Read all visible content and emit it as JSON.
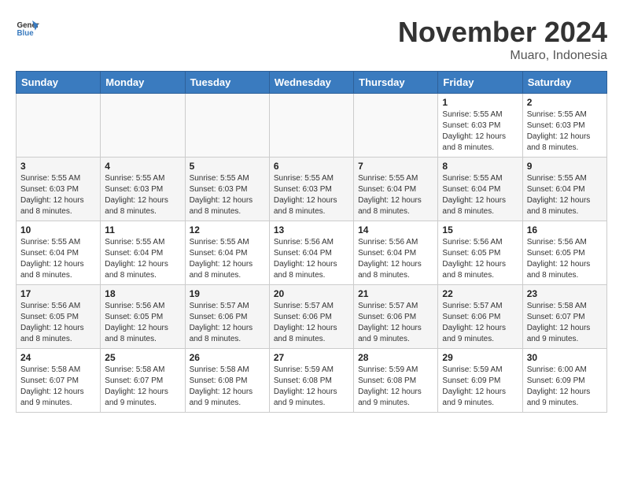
{
  "header": {
    "logo_line1": "General",
    "logo_line2": "Blue",
    "month": "November 2024",
    "location": "Muaro, Indonesia"
  },
  "days_of_week": [
    "Sunday",
    "Monday",
    "Tuesday",
    "Wednesday",
    "Thursday",
    "Friday",
    "Saturday"
  ],
  "weeks": [
    [
      {
        "day": "",
        "info": ""
      },
      {
        "day": "",
        "info": ""
      },
      {
        "day": "",
        "info": ""
      },
      {
        "day": "",
        "info": ""
      },
      {
        "day": "",
        "info": ""
      },
      {
        "day": "1",
        "info": "Sunrise: 5:55 AM\nSunset: 6:03 PM\nDaylight: 12 hours and 8 minutes."
      },
      {
        "day": "2",
        "info": "Sunrise: 5:55 AM\nSunset: 6:03 PM\nDaylight: 12 hours and 8 minutes."
      }
    ],
    [
      {
        "day": "3",
        "info": "Sunrise: 5:55 AM\nSunset: 6:03 PM\nDaylight: 12 hours and 8 minutes."
      },
      {
        "day": "4",
        "info": "Sunrise: 5:55 AM\nSunset: 6:03 PM\nDaylight: 12 hours and 8 minutes."
      },
      {
        "day": "5",
        "info": "Sunrise: 5:55 AM\nSunset: 6:03 PM\nDaylight: 12 hours and 8 minutes."
      },
      {
        "day": "6",
        "info": "Sunrise: 5:55 AM\nSunset: 6:03 PM\nDaylight: 12 hours and 8 minutes."
      },
      {
        "day": "7",
        "info": "Sunrise: 5:55 AM\nSunset: 6:04 PM\nDaylight: 12 hours and 8 minutes."
      },
      {
        "day": "8",
        "info": "Sunrise: 5:55 AM\nSunset: 6:04 PM\nDaylight: 12 hours and 8 minutes."
      },
      {
        "day": "9",
        "info": "Sunrise: 5:55 AM\nSunset: 6:04 PM\nDaylight: 12 hours and 8 minutes."
      }
    ],
    [
      {
        "day": "10",
        "info": "Sunrise: 5:55 AM\nSunset: 6:04 PM\nDaylight: 12 hours and 8 minutes."
      },
      {
        "day": "11",
        "info": "Sunrise: 5:55 AM\nSunset: 6:04 PM\nDaylight: 12 hours and 8 minutes."
      },
      {
        "day": "12",
        "info": "Sunrise: 5:55 AM\nSunset: 6:04 PM\nDaylight: 12 hours and 8 minutes."
      },
      {
        "day": "13",
        "info": "Sunrise: 5:56 AM\nSunset: 6:04 PM\nDaylight: 12 hours and 8 minutes."
      },
      {
        "day": "14",
        "info": "Sunrise: 5:56 AM\nSunset: 6:04 PM\nDaylight: 12 hours and 8 minutes."
      },
      {
        "day": "15",
        "info": "Sunrise: 5:56 AM\nSunset: 6:05 PM\nDaylight: 12 hours and 8 minutes."
      },
      {
        "day": "16",
        "info": "Sunrise: 5:56 AM\nSunset: 6:05 PM\nDaylight: 12 hours and 8 minutes."
      }
    ],
    [
      {
        "day": "17",
        "info": "Sunrise: 5:56 AM\nSunset: 6:05 PM\nDaylight: 12 hours and 8 minutes."
      },
      {
        "day": "18",
        "info": "Sunrise: 5:56 AM\nSunset: 6:05 PM\nDaylight: 12 hours and 8 minutes."
      },
      {
        "day": "19",
        "info": "Sunrise: 5:57 AM\nSunset: 6:06 PM\nDaylight: 12 hours and 8 minutes."
      },
      {
        "day": "20",
        "info": "Sunrise: 5:57 AM\nSunset: 6:06 PM\nDaylight: 12 hours and 8 minutes."
      },
      {
        "day": "21",
        "info": "Sunrise: 5:57 AM\nSunset: 6:06 PM\nDaylight: 12 hours and 9 minutes."
      },
      {
        "day": "22",
        "info": "Sunrise: 5:57 AM\nSunset: 6:06 PM\nDaylight: 12 hours and 9 minutes."
      },
      {
        "day": "23",
        "info": "Sunrise: 5:58 AM\nSunset: 6:07 PM\nDaylight: 12 hours and 9 minutes."
      }
    ],
    [
      {
        "day": "24",
        "info": "Sunrise: 5:58 AM\nSunset: 6:07 PM\nDaylight: 12 hours and 9 minutes."
      },
      {
        "day": "25",
        "info": "Sunrise: 5:58 AM\nSunset: 6:07 PM\nDaylight: 12 hours and 9 minutes."
      },
      {
        "day": "26",
        "info": "Sunrise: 5:58 AM\nSunset: 6:08 PM\nDaylight: 12 hours and 9 minutes."
      },
      {
        "day": "27",
        "info": "Sunrise: 5:59 AM\nSunset: 6:08 PM\nDaylight: 12 hours and 9 minutes."
      },
      {
        "day": "28",
        "info": "Sunrise: 5:59 AM\nSunset: 6:08 PM\nDaylight: 12 hours and 9 minutes."
      },
      {
        "day": "29",
        "info": "Sunrise: 5:59 AM\nSunset: 6:09 PM\nDaylight: 12 hours and 9 minutes."
      },
      {
        "day": "30",
        "info": "Sunrise: 6:00 AM\nSunset: 6:09 PM\nDaylight: 12 hours and 9 minutes."
      }
    ]
  ]
}
